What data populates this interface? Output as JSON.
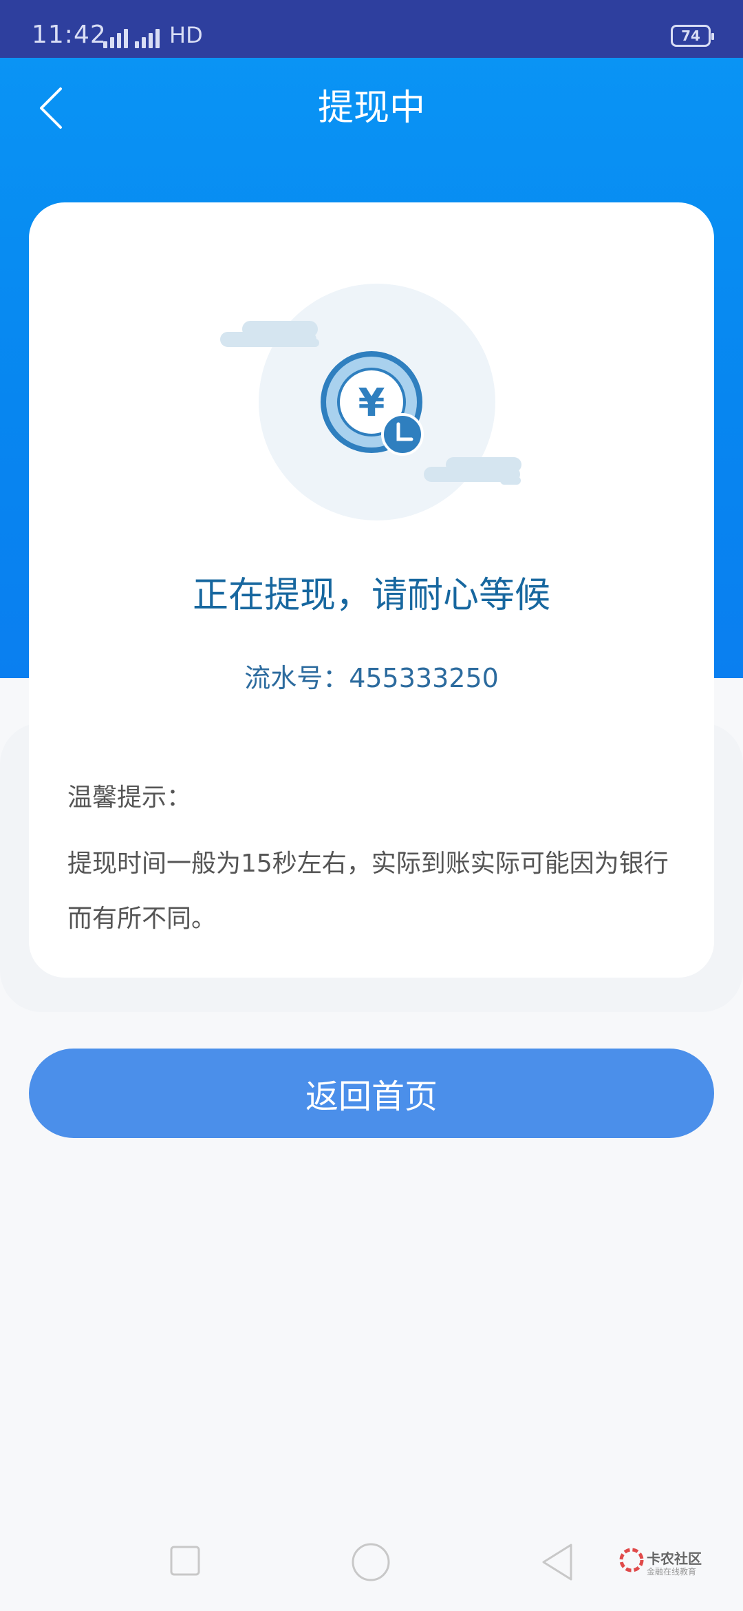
{
  "status_bar": {
    "time": "11:42",
    "signal1_label": "4G",
    "signal2_label": "4G",
    "hd_label": "HD",
    "battery": "74"
  },
  "header": {
    "title": "提现中",
    "back_icon": "chevron-left-icon"
  },
  "card": {
    "illustration_icon": "yuan-coin-clock-icon",
    "status_message": "正在提现，请耐心等候",
    "serial_label": "流水号：455333250",
    "tip_title": "温馨提示：",
    "tip_body": "提现时间一般为15秒左右，实际到账实际可能因为银行而有所不同。"
  },
  "actions": {
    "home_button_label": "返回首页"
  },
  "system_nav": {
    "recent_icon": "square-icon",
    "home_icon": "circle-icon",
    "back_icon": "triangle-back-icon"
  },
  "watermark": {
    "title": "卡农社区",
    "subtitle": "金融在线教育"
  },
  "colors": {
    "header_blue": "#0a96f5",
    "primary_text": "#17679f",
    "button_blue": "#4b8fea",
    "status_bar": "#2e3f9e"
  }
}
